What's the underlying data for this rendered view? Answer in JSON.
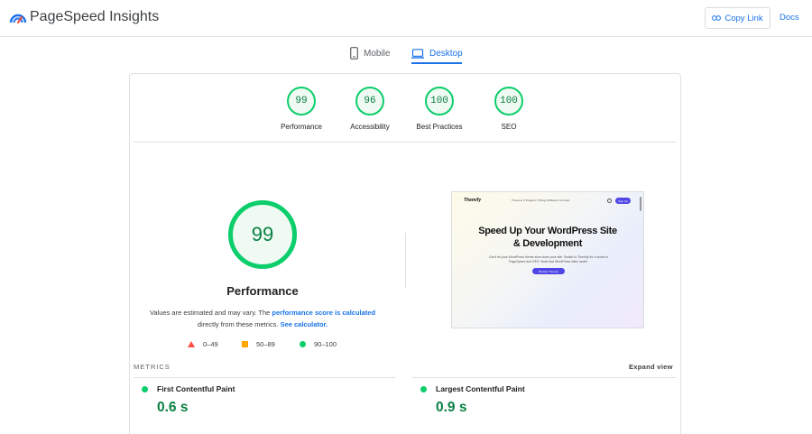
{
  "header": {
    "brand": "PageSpeed Insights",
    "copy_link_label": "Copy Link",
    "docs_label": "Docs"
  },
  "tabs": [
    {
      "label": "Mobile",
      "active": false
    },
    {
      "label": "Desktop",
      "active": true
    }
  ],
  "categories": [
    {
      "score": "99",
      "label": "Performance"
    },
    {
      "score": "96",
      "label": "Accessibility"
    },
    {
      "score": "100",
      "label": "Best Practices"
    },
    {
      "score": "100",
      "label": "SEO"
    }
  ],
  "performance": {
    "score": "99",
    "title": "Performance",
    "note_prefix": "Values are estimated and may vary. The ",
    "note_link1": "performance score is calculated",
    "note_middle": " directly from these metrics. ",
    "note_link2": "See calculator."
  },
  "legend": [
    {
      "shape": "triangle",
      "label": "0–49",
      "color": "#ff4e42"
    },
    {
      "shape": "square",
      "label": "50–89",
      "color": "#ffa400"
    },
    {
      "shape": "circle",
      "label": "90–100",
      "color": "#0cce6b"
    }
  ],
  "screenshot": {
    "logo": "Themify",
    "nav": "Themes ▾   Plugins ▾   Blog   Affiliates   Contact",
    "nav_button": "Sign Up",
    "title_line1": "Speed Up Your WordPress Site",
    "title_line2": "& Development",
    "subtitle": "Don't let your WordPress theme slow down your site. Switch to Themify for a boost in PageSpeed and SEO. Build fast WordPress sites, faster.",
    "cta": "Browse Themes"
  },
  "metrics": {
    "section_label": "METRICS",
    "expand_label": "Expand view",
    "items": [
      {
        "name": "First Contentful Paint",
        "value": "0.6 s"
      },
      {
        "name": "Largest Contentful Paint",
        "value": "0.9 s"
      }
    ]
  },
  "colors": {
    "accent": "#1a73e8",
    "pass": "#0cce6b",
    "pass_text": "#0b8043",
    "average": "#ffa400",
    "fail": "#ff4e42"
  }
}
